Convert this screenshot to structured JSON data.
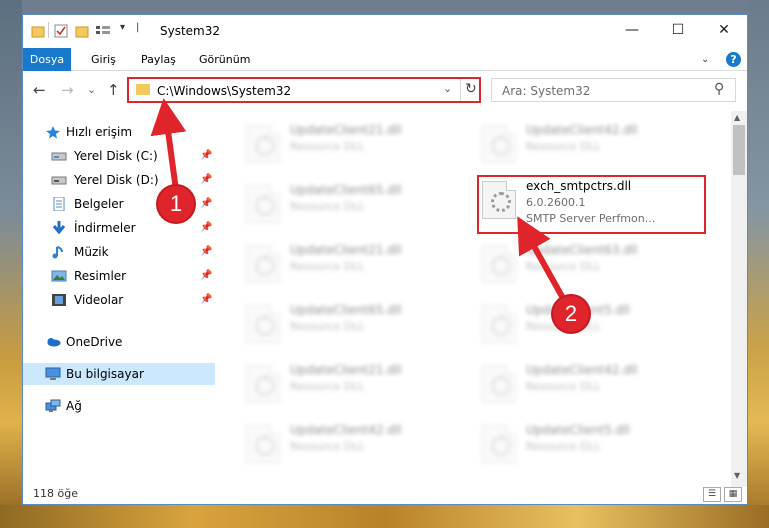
{
  "window": {
    "title": "System32",
    "controls": {
      "minimize": "—",
      "maximize": "☐",
      "close": "✕"
    }
  },
  "ribbon": {
    "tabs": [
      {
        "label": "Dosya",
        "active": true
      },
      {
        "label": "Giriş"
      },
      {
        "label": "Paylaş"
      },
      {
        "label": "Görünüm"
      }
    ],
    "help": "?"
  },
  "nav": {
    "back": "←",
    "forward": "→",
    "recent": "⌄",
    "up": "↑",
    "address": "C:\\Windows\\System32",
    "address_dropdown": "⌄",
    "refresh": "↻",
    "search_placeholder": "Ara: System32",
    "search_icon": "⚲"
  },
  "sidebar": {
    "items": [
      {
        "label": "Hızlı erişim",
        "icon": "star-icon"
      },
      {
        "label": "Yerel Disk (C:)",
        "icon": "drive-icon",
        "pinned": true
      },
      {
        "label": "Yerel Disk (D:)",
        "icon": "drive-icon",
        "pinned": true
      },
      {
        "label": "Belgeler",
        "icon": "documents-icon",
        "pinned": true
      },
      {
        "label": "İndirmeler",
        "icon": "download-icon",
        "pinned": true
      },
      {
        "label": "Müzik",
        "icon": "music-icon",
        "pinned": true
      },
      {
        "label": "Resimler",
        "icon": "pictures-icon",
        "pinned": true
      },
      {
        "label": "Videolar",
        "icon": "videos-icon",
        "pinned": true
      },
      {
        "label": "OneDrive",
        "icon": "cloud-icon"
      },
      {
        "label": "Bu bilgisayar",
        "icon": "computer-icon",
        "selected": true
      },
      {
        "label": "Ağ",
        "icon": "network-icon"
      }
    ],
    "pin_glyph": "📌"
  },
  "files": {
    "left_column": [
      {
        "name": "UpdateClient21.dll",
        "desc": "Resource DLL"
      },
      {
        "name": "UpdateClient65.dll",
        "desc": "Resource DLL"
      },
      {
        "name": "UpdateClient21.dll",
        "desc": "Resource DLL"
      },
      {
        "name": "UpdateClient65.dll",
        "desc": "Resource DLL"
      },
      {
        "name": "UpdateClient21.dll",
        "desc": "Resource DLL"
      },
      {
        "name": "UpdateClient42.dll",
        "desc": "Resource DLL"
      }
    ],
    "right_column": [
      {
        "name": "UpdateClient42.dll",
        "desc": "Resource DLL"
      },
      {
        "name": "UpdateClient63.dll",
        "desc": "Resource DLL"
      },
      {
        "name": "UpdateClient5.dll",
        "desc": "Resource DLL"
      },
      {
        "name": "UpdateClient42.dll",
        "desc": "Resource DLL"
      },
      {
        "name": "UpdateClient5.dll",
        "desc": "Resource DLL"
      }
    ],
    "highlighted": {
      "name": "exch_smtpctrs.dll",
      "version": "6.0.2600.1",
      "desc": "SMTP Server Perfmon..."
    }
  },
  "status": {
    "count": "118 öğe"
  },
  "callouts": [
    {
      "number": "1"
    },
    {
      "number": "2"
    }
  ],
  "colors": {
    "accent": "#1979ca",
    "callout": "#e0242b",
    "selected": "#cce8ff"
  }
}
